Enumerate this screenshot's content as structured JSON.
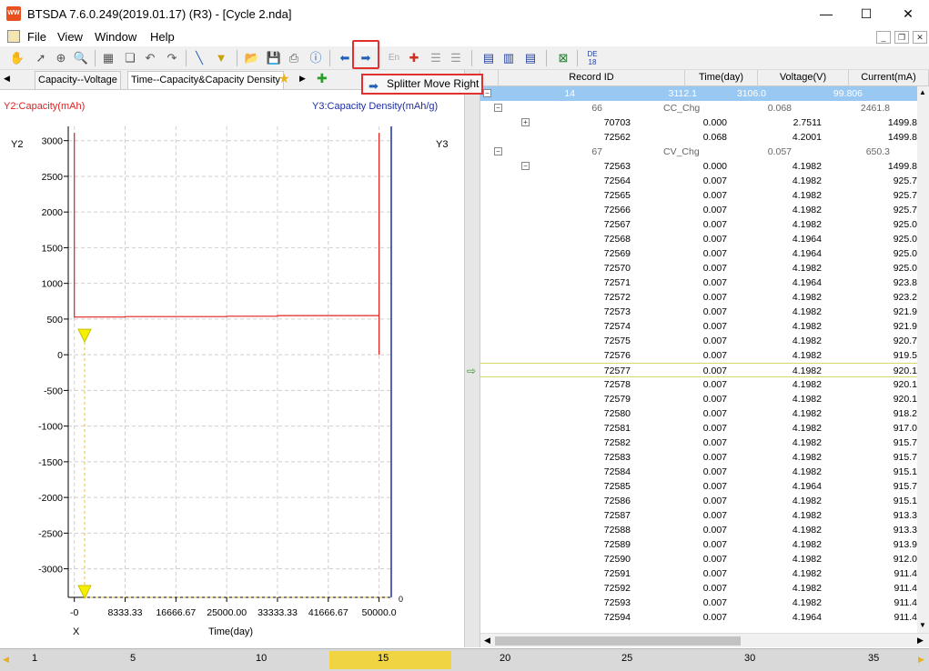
{
  "window": {
    "title": "BTSDA 7.6.0.249(2019.01.17) (R3) - [Cycle 2.nda]",
    "app_icon": "WW",
    "minimize": "—",
    "maximize": "☐",
    "close": "✕"
  },
  "menu": {
    "items": [
      "File",
      "View",
      "Window",
      "Help"
    ]
  },
  "tooltip": {
    "label": "Splitter Move Right"
  },
  "tabs": {
    "items": [
      "Capacity--Voltage",
      "Time--Capacity&Capacity Density"
    ]
  },
  "chart": {
    "y2_title": "Y2:Capacity(mAh)",
    "y3_title": "Y3:Capacity Density(mAh/g)",
    "y2_label": "Y2",
    "y3_label": "Y3",
    "x_label": "X",
    "xlabel": "Time(day)",
    "y3_tick": "0",
    "y2_color": "#e02020",
    "y3_color": "#1f2fa0",
    "chart_data": {
      "type": "line",
      "xlabel": "Time(day)",
      "ylabel": "Capacity(mAh)",
      "xlim": [
        -1000,
        52000
      ],
      "ylim": [
        -3400,
        3200
      ],
      "x_ticks": [
        "-0",
        "8333.33",
        "16666.67",
        "25000.00",
        "33333.33",
        "41666.67",
        "50000.0"
      ],
      "x_tick_values": [
        0,
        8333.33,
        16666.67,
        25000,
        33333.33,
        41666.67,
        50000
      ],
      "y_ticks": [
        "3000",
        "2500",
        "2000",
        "1500",
        "1000",
        "500",
        "0",
        "-500",
        "-1000",
        "-1500",
        "-2000",
        "-2500",
        "-3000"
      ],
      "y_tick_values": [
        3000,
        2500,
        2000,
        1500,
        1000,
        500,
        0,
        -500,
        -1000,
        -1500,
        -2000,
        -2500,
        -3000
      ],
      "series": [
        {
          "x": [
            0,
            0,
            8333,
            8334,
            25000,
            25001,
            33333,
            33334,
            50000,
            50000,
            50000
          ],
          "y": [
            3110,
            528,
            528,
            535,
            535,
            540,
            540,
            548,
            548,
            3110,
            0
          ]
        }
      ],
      "grid": true
    }
  },
  "grid": {
    "columns": [
      "Record ID",
      "Time(day)",
      "Voltage(V)",
      "Current(mA)"
    ],
    "summary_row": [
      "14",
      "3112.1",
      "3106.0",
      "99.806"
    ],
    "groups": [
      {
        "cycle": "66",
        "step": "CC_Chg",
        "time": "0.068",
        "current": "2461.8",
        "records": [
          [
            "70703",
            "0.000",
            "2.7511",
            "1499.8"
          ],
          [
            "72562",
            "0.068",
            "4.2001",
            "1499.8"
          ]
        ]
      },
      {
        "cycle": "67",
        "step": "CV_Chg",
        "time": "0.057",
        "current": "650.3",
        "records": [
          [
            "72563",
            "0.000",
            "4.1982",
            "1499.8"
          ],
          [
            "72564",
            "0.007",
            "4.1982",
            "925.7"
          ],
          [
            "72565",
            "0.007",
            "4.1982",
            "925.7"
          ],
          [
            "72566",
            "0.007",
            "4.1982",
            "925.7"
          ],
          [
            "72567",
            "0.007",
            "4.1982",
            "925.0"
          ],
          [
            "72568",
            "0.007",
            "4.1964",
            "925.0"
          ],
          [
            "72569",
            "0.007",
            "4.1964",
            "925.0"
          ],
          [
            "72570",
            "0.007",
            "4.1982",
            "925.0"
          ],
          [
            "72571",
            "0.007",
            "4.1964",
            "923.8"
          ],
          [
            "72572",
            "0.007",
            "4.1982",
            "923.2"
          ],
          [
            "72573",
            "0.007",
            "4.1982",
            "921.9"
          ],
          [
            "72574",
            "0.007",
            "4.1982",
            "921.9"
          ],
          [
            "72575",
            "0.007",
            "4.1982",
            "920.7"
          ],
          [
            "72576",
            "0.007",
            "4.1982",
            "919.5"
          ],
          [
            "72577",
            "0.007",
            "4.1982",
            "920.1"
          ],
          [
            "72578",
            "0.007",
            "4.1982",
            "920.1"
          ],
          [
            "72579",
            "0.007",
            "4.1982",
            "920.1"
          ],
          [
            "72580",
            "0.007",
            "4.1982",
            "918.2"
          ],
          [
            "72581",
            "0.007",
            "4.1982",
            "917.0"
          ],
          [
            "72582",
            "0.007",
            "4.1982",
            "915.7"
          ],
          [
            "72583",
            "0.007",
            "4.1982",
            "915.7"
          ],
          [
            "72584",
            "0.007",
            "4.1982",
            "915.1"
          ],
          [
            "72585",
            "0.007",
            "4.1964",
            "915.7"
          ],
          [
            "72586",
            "0.007",
            "4.1982",
            "915.1"
          ],
          [
            "72587",
            "0.007",
            "4.1982",
            "913.3"
          ],
          [
            "72588",
            "0.007",
            "4.1982",
            "913.3"
          ],
          [
            "72589",
            "0.007",
            "4.1982",
            "913.9"
          ],
          [
            "72590",
            "0.007",
            "4.1982",
            "912.0"
          ],
          [
            "72591",
            "0.007",
            "4.1982",
            "911.4"
          ],
          [
            "72592",
            "0.007",
            "4.1982",
            "911.4"
          ],
          [
            "72593",
            "0.007",
            "4.1982",
            "911.4"
          ],
          [
            "72594",
            "0.007",
            "4.1964",
            "911.4"
          ]
        ]
      }
    ],
    "current_record": "72577"
  },
  "cycle_bar": {
    "labels": [
      "1",
      "5",
      "10",
      "15",
      "20",
      "25",
      "30",
      "35"
    ],
    "selected": "15"
  }
}
